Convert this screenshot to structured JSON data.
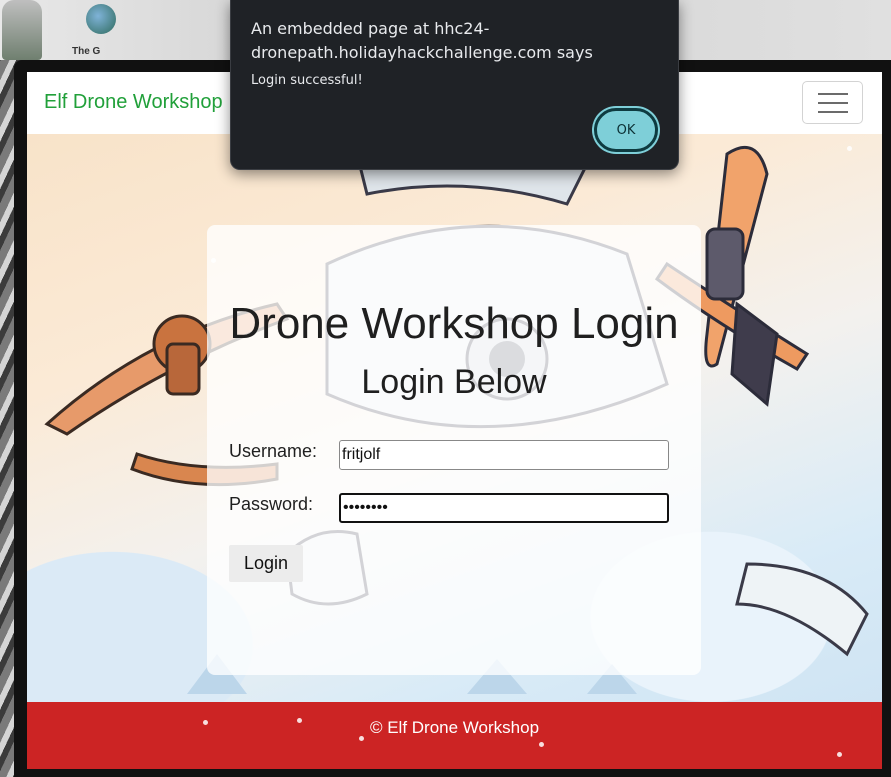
{
  "game": {
    "caption": "The G"
  },
  "navbar": {
    "brand": "Elf Drone Workshop",
    "toggler_icon": "hamburger-menu-icon"
  },
  "login": {
    "title": "Drone Workshop Login",
    "subtitle": "Login Below",
    "username_label": "Username:",
    "username_value": "fritjolf",
    "password_label": "Password:",
    "password_value": "••••••••",
    "button_label": "Login"
  },
  "footer": {
    "text": "© Elf Drone Workshop"
  },
  "dialog": {
    "title": "An embedded page at hhc24-dronepath.holidayhackchallenge.com says",
    "message": "Login successful!",
    "ok_label": "OK"
  },
  "colors": {
    "brand": "#21a03a",
    "footer": "#cc2424",
    "dialog_bg": "#1f2226",
    "ok_button": "#7ecfd8"
  }
}
